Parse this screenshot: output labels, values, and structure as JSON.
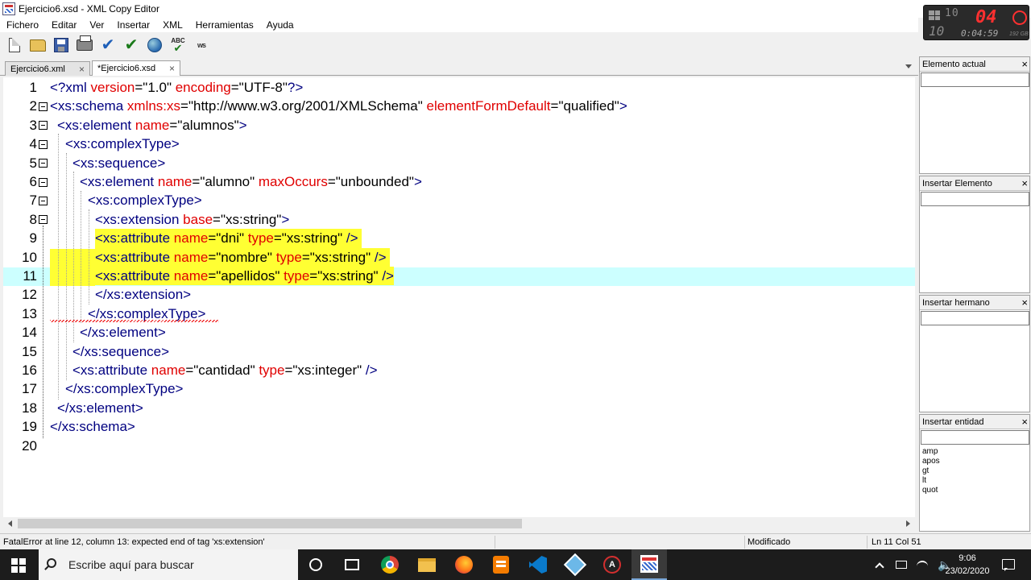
{
  "window": {
    "title": "Ejercicio6.xsd - XML Copy Editor"
  },
  "recorder": {
    "big": "10",
    "red": "04",
    "left": "10",
    "time": "0:04:59",
    "disk": "192 GB"
  },
  "menu": [
    "Fichero",
    "Editar",
    "Ver",
    "Insertar",
    "XML",
    "Herramientas",
    "Ayuda"
  ],
  "toolbar": {
    "icons": [
      "new-document-icon",
      "open-folder-icon",
      "save-icon",
      "print-icon",
      "check-well-formed-icon",
      "validate-icon",
      "browser-icon",
      "spellcheck-icon",
      "word-wrap-icon"
    ],
    "spell_label": "ABC",
    "wrap_label": "ws"
  },
  "tabs": [
    {
      "label": "Ejercicio6.xml",
      "close": "×",
      "active": false
    },
    {
      "label": "*Ejercicio6.xsd",
      "close": "×",
      "active": true
    }
  ],
  "editor": {
    "lines": [
      {
        "n": "1"
      },
      {
        "n": "2"
      },
      {
        "n": "3"
      },
      {
        "n": "4"
      },
      {
        "n": "5"
      },
      {
        "n": "6"
      },
      {
        "n": "7"
      },
      {
        "n": "8"
      },
      {
        "n": "9"
      },
      {
        "n": "10"
      },
      {
        "n": "11"
      },
      {
        "n": "12"
      },
      {
        "n": "13"
      },
      {
        "n": "14"
      },
      {
        "n": "15"
      },
      {
        "n": "16"
      },
      {
        "n": "17"
      },
      {
        "n": "18"
      },
      {
        "n": "19"
      },
      {
        "n": "20"
      }
    ],
    "code": {
      "l1": {
        "a": "<?xml",
        "b": " version",
        "c": "=\"1.0\"",
        "d": " encoding",
        "e": "=\"UTF-8\"",
        "f": "?>"
      },
      "l2": {
        "a": "<xs:schema",
        "b": " xmlns:xs",
        "c": "=\"http://www.w3.org/2001/XMLSchema\"",
        "d": " elementFormDefault",
        "e": "=\"qualified\"",
        "f": ">"
      },
      "l3": {
        "a": "<xs:element",
        "b": " name",
        "c": "=\"alumnos\"",
        "f": ">"
      },
      "l4": {
        "a": "<xs:complexType>"
      },
      "l5": {
        "a": "<xs:sequence>"
      },
      "l6": {
        "a": "<xs:element",
        "b": " name",
        "c": "=\"alumno\"",
        "d": " maxOccurs",
        "e": "=\"unbounded\"",
        "f": ">"
      },
      "l7": {
        "a": "<xs:complexType>"
      },
      "l8": {
        "a": "<xs:extension",
        "b": " base",
        "c": "=\"xs:string\"",
        "f": ">"
      },
      "l9": {
        "a": "<xs:attribute",
        "b": " name",
        "c": "=\"dni\"",
        "d": " type",
        "e": "=\"xs:string\"",
        "f": " />"
      },
      "l10": {
        "a": "<xs:attribute",
        "b": " name",
        "c": "=\"nombre\"",
        "d": " type",
        "e": "=\"xs:string\"",
        "f": " />"
      },
      "l11": {
        "a": "<xs:attribute",
        "b": " name",
        "c": "=\"apellidos\"",
        "d": " type",
        "e": "=\"xs:string\"",
        "f": " />"
      },
      "l12": {
        "a": "</xs:extension>"
      },
      "l13": {
        "a": "</xs:complexType>"
      },
      "l14": {
        "a": "</xs:element>"
      },
      "l15": {
        "a": "</xs:sequence>"
      },
      "l16": {
        "a": "<xs:attribute",
        "b": " name",
        "c": "=\"cantidad\"",
        "d": " type",
        "e": "=\"xs:integer\"",
        "f": " />"
      },
      "l17": {
        "a": "</xs:complexType>"
      },
      "l18": {
        "a": "</xs:element>"
      },
      "l19": {
        "a": "</xs:schema>"
      }
    },
    "colors": {
      "tag": "#000080",
      "attr": "#e00000",
      "highlight": "#ffff33",
      "current_line": "#ccffff"
    }
  },
  "panels": {
    "current": {
      "title": "Elemento actual",
      "close": "×"
    },
    "insert_element": {
      "title": "Insertar Elemento",
      "close": "×"
    },
    "insert_sibling": {
      "title": "Insertar hermano",
      "close": "×"
    },
    "insert_entity": {
      "title": "Insertar entidad",
      "close": "×",
      "items": [
        "amp",
        "apos",
        "gt",
        "lt",
        "quot"
      ]
    }
  },
  "status": {
    "message": "FatalError at line 12, column 13: expected end of tag 'xs:extension'",
    "modified": "Modificado",
    "position": "Ln 11 Col 51"
  },
  "taskbar": {
    "search_placeholder": "Escribe aquí para buscar",
    "apps": [
      "cortana-icon",
      "task-view-icon",
      "chrome-icon",
      "file-explorer-icon",
      "firefox-icon",
      "sublime-text-icon",
      "vscode-icon",
      "cube-app-icon",
      "a-app-icon",
      "xml-copy-editor-icon"
    ],
    "a_label": "A",
    "time": "9:06",
    "date": "23/02/2020"
  }
}
